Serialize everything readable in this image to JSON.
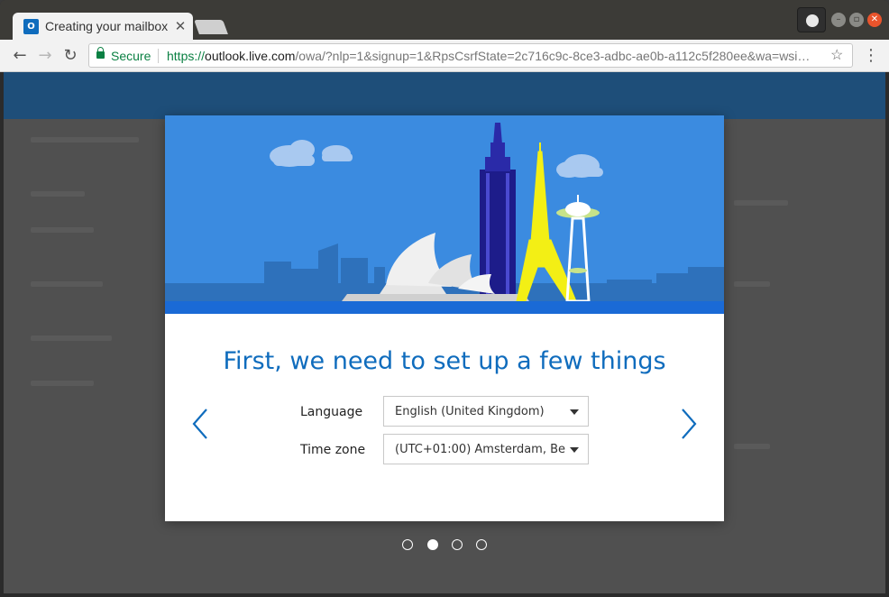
{
  "browser": {
    "tab_title": "Creating your mailbox",
    "favicon_letter": "O",
    "secure_label": "Secure",
    "url_scheme": "https://",
    "url_host": "outlook.live.com",
    "url_rest": "/owa/?nlp=1&signup=1&RpsCsrfState=2c716c9c-8ce3-adbc-ae0b-a112c5f280ee&wa=wsi…"
  },
  "dialog": {
    "headline": "First, we need to set up a few things",
    "language_label": "Language",
    "language_value": "English (United Kingdom)",
    "timezone_label": "Time zone",
    "timezone_value": "(UTC+01:00) Amsterdam, Be..."
  },
  "pager": {
    "total": 4,
    "active_index": 1
  },
  "colors": {
    "accent": "#0f6cbd",
    "hero_sky": "#3b8be0",
    "header": "#1e4e79"
  }
}
